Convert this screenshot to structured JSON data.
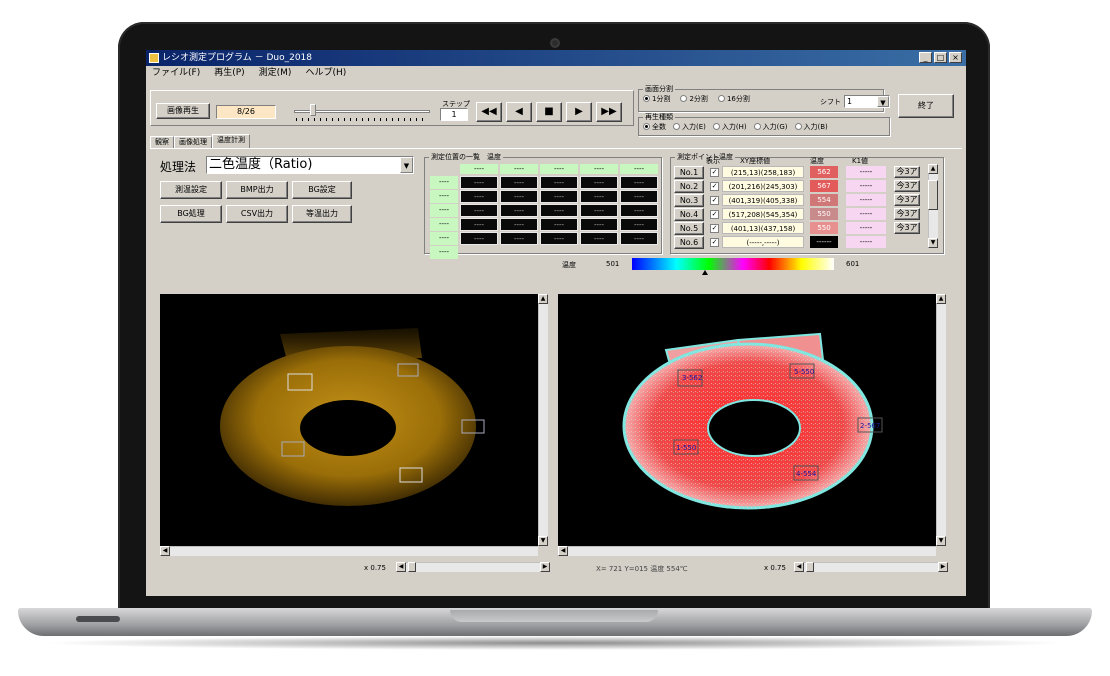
{
  "window": {
    "title": "レシオ測定プログラム － Duo_2018",
    "buttons": [
      "_",
      "□",
      "×"
    ]
  },
  "menu": [
    "ファイル(F)",
    "再生(P)",
    "測定(M)",
    "ヘルプ(H)"
  ],
  "toolbar": {
    "open_label": "画像再生",
    "progress_text": "8/26",
    "step_label": "ステップ",
    "step_value": "1",
    "media": [
      "◀◀",
      "◀",
      "■",
      "▶",
      "▶▶"
    ],
    "close_label": "終了"
  },
  "display_group": {
    "legend": "画面分割",
    "options": [
      "1分割",
      "2分割",
      "16分割"
    ],
    "selected": 0,
    "shift_label": "シフト",
    "shift_value": "1"
  },
  "playback_group": {
    "legend": "再生種類",
    "options": [
      "全数",
      "入力(E)",
      "入力(H)",
      "入力(G)",
      "入力(B)"
    ],
    "selected": 0
  },
  "tabs": [
    "観察",
    "画像処理",
    "温度計測"
  ],
  "active_tab": 2,
  "method": {
    "label": "処理法",
    "value": "二色温度（Ratio)"
  },
  "action_buttons": [
    "測温設定",
    "BMP出力",
    "BG設定",
    "BG処理",
    "CSV出力",
    "等温出力"
  ],
  "grid": {
    "legend": "測定位置の一覧",
    "legend2": "温度",
    "headers": [
      "----",
      "----",
      "----",
      "----",
      "----"
    ],
    "rows": [
      "----",
      "----",
      "----",
      "----",
      "----",
      "----"
    ],
    "cell": "----"
  },
  "points": {
    "legend": "測定ポイント温度",
    "col_show": "表示",
    "col_xy": "XY座標値",
    "col_temp": "温度",
    "col_k": "K1値",
    "rows": [
      {
        "no": "No.1",
        "xy": "(215,13)(258,183)",
        "temp": "562",
        "temp_color": "#e06060",
        "k": "-----",
        "checked": true
      },
      {
        "no": "No.2",
        "xy": "(201,216)(245,303)",
        "temp": "567",
        "temp_color": "#e25a5a",
        "k": "-----",
        "checked": true
      },
      {
        "no": "No.3",
        "xy": "(401,319)(405,338)",
        "temp": "554",
        "temp_color": "#d07878",
        "k": "-----",
        "checked": true
      },
      {
        "no": "No.4",
        "xy": "(517,208)(545,354)",
        "temp": "550",
        "temp_color": "#c88a8a",
        "k": "-----",
        "checked": true
      },
      {
        "no": "No.5",
        "xy": "(401,13)(437,158)",
        "temp": "550",
        "temp_color": "#e89090",
        "k": "-----",
        "checked": true
      },
      {
        "no": "No.6",
        "xy": "(-----,-----)",
        "temp": "------",
        "temp_color": "#000000",
        "k": "-----",
        "checked": true
      }
    ],
    "set_label": "今3ア"
  },
  "colorbar": {
    "label": "温度",
    "min": "501",
    "max": "601"
  },
  "left_view": {
    "zoom": "x 0.75"
  },
  "right_view": {
    "zoom": "x 0.75",
    "labels": [
      "3-562",
      "5-550",
      "2-567",
      "1-550",
      "4-554"
    ],
    "status": "X= 721 Y=015 温度 554℃"
  }
}
